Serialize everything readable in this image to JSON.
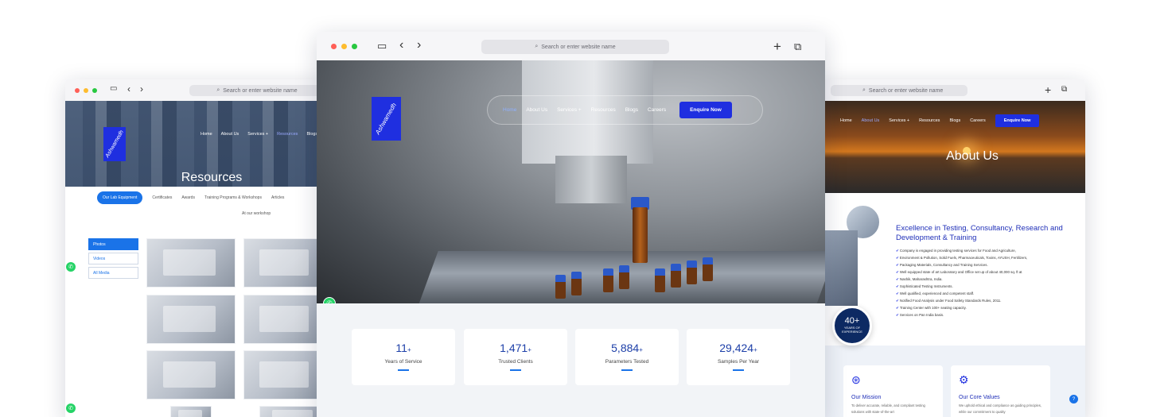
{
  "common": {
    "url_placeholder": "Search or enter website name",
    "logo_text": "Ashwamedh",
    "colors": {
      "brand_blue": "#1f2fe0",
      "accent_blue": "#1a73e8",
      "whatsapp_green": "#25d366"
    }
  },
  "left": {
    "nav": [
      "Home",
      "About Us",
      "Services +",
      "Resources",
      "Blogs"
    ],
    "active_nav": "Resources",
    "title": "Resources",
    "tabs": [
      "Our Lab Equipment",
      "Certificates",
      "Awards",
      "Training Programs & Workshops",
      "Articles"
    ],
    "tab_sub": "At our workshop",
    "side_items": [
      "Photos",
      "Videos",
      "All Media"
    ]
  },
  "center": {
    "nav": [
      "Home",
      "About Us",
      "Services +",
      "Resources",
      "Blogs",
      "Careers"
    ],
    "active_nav": "Home",
    "cta": "Enquire Now",
    "stats": [
      {
        "value": "11",
        "suffix": "+",
        "label": "Years of Service"
      },
      {
        "value": "1,471",
        "suffix": "+",
        "label": "Trusted Clients"
      },
      {
        "value": "5,884",
        "suffix": "+",
        "label": "Parameters Tested"
      },
      {
        "value": "29,424",
        "suffix": "+",
        "label": "Samples Per Year"
      }
    ]
  },
  "right": {
    "nav": [
      "Home",
      "About Us",
      "Services +",
      "Resources",
      "Blogs",
      "Careers"
    ],
    "active_nav": "About Us",
    "cta": "Enquire Now",
    "title": "About Us",
    "heading": "Excellence in Testing, Consultancy, Research and Development & Training",
    "bullets": [
      "Company is engaged in providing testing services for Food and Agriculture,",
      "Environment & Pollution, Solid Fuels, Pharmaceuticals, Toxins, AYUSH, Fertilizers,",
      "Packaging Materials, Consultancy and Training Services.",
      "Well equipped state of art Laboratory and Office set up of about 40,000 sq. ft at",
      "Nashik, Maharashtra, India.",
      "Sophisticated Testing Instruments.",
      "Well qualified, experienced and competent staff.",
      "Notified Food Analysis under Food Safety Standards Rules, 2011.",
      "Training Center with 100+ seating capacity.",
      "Services on Pan India basis."
    ],
    "badge_value": "40+",
    "badge_label_1": "YEARS OF",
    "badge_label_2": "EXPERIENCE",
    "cards": [
      {
        "title": "Our Mission",
        "desc": "To deliver accurate, reliable, and compliant testing solutions with state-of-the-art"
      },
      {
        "title": "Our Core Values",
        "desc": "We uphold ethical and compliance as guiding principles, while our commitment to quality"
      }
    ]
  }
}
